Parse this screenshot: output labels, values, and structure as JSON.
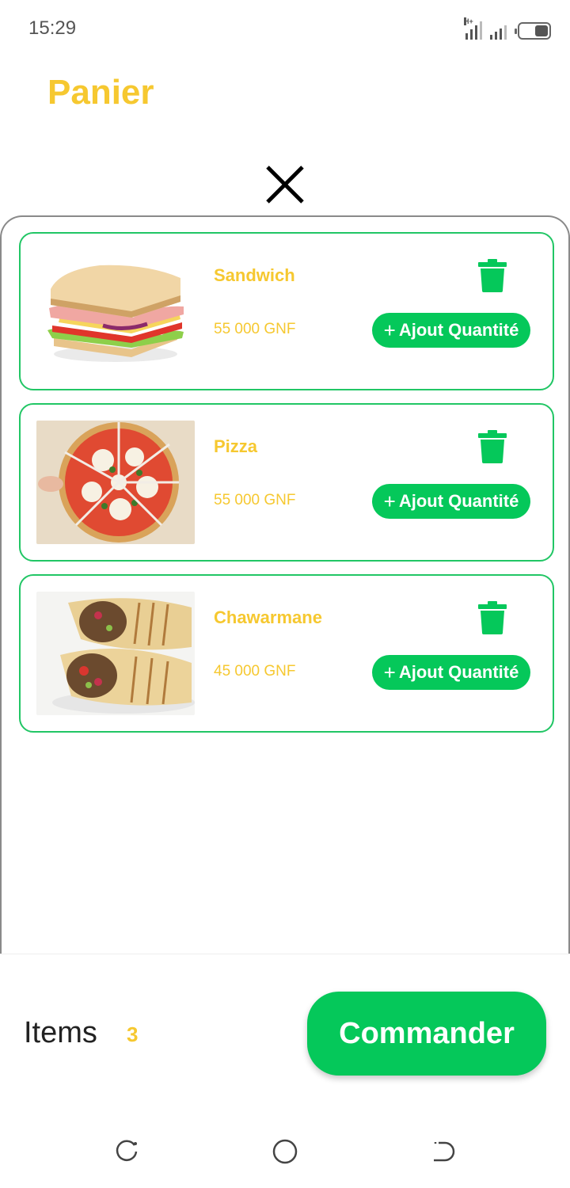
{
  "status_bar": {
    "time": "15:29",
    "network_label": "H+"
  },
  "header": {
    "title": "Panier"
  },
  "cart": {
    "items": [
      {
        "name": "Sandwich",
        "price": "55 000 GNF",
        "add_label": "Ajout Quantité",
        "image": "sandwich-photo"
      },
      {
        "name": "Pizza",
        "price": "55 000 GNF",
        "add_label": "Ajout Quantité",
        "image": "pizza-photo"
      },
      {
        "name": "Chawarmane",
        "price": "45 000 GNF",
        "add_label": "Ajout Quantité",
        "image": "shawarma-photo"
      }
    ]
  },
  "footer": {
    "items_label": "Items",
    "items_count": "3",
    "order_label": "Commander"
  },
  "colors": {
    "accent_yellow": "#f6c830",
    "accent_green": "#05c85a",
    "card_border": "#21c665"
  },
  "icons": {
    "close": "close-icon",
    "delete": "trash-icon",
    "add": "plus-icon",
    "nav_recent": "recent-apps-icon",
    "nav_home": "home-icon",
    "nav_back": "back-icon"
  }
}
